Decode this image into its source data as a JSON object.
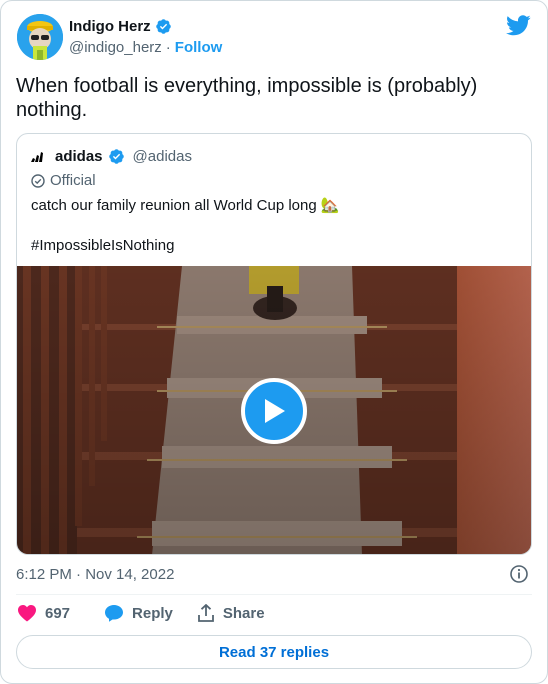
{
  "author": {
    "name": "Indigo Herz",
    "handle": "@indigo_herz",
    "separator": "·",
    "follow_label": "Follow"
  },
  "tweet": {
    "text": "When football is everything, impossible is (probably) nothing."
  },
  "quote": {
    "name": "adidas",
    "handle": "@adidas",
    "official_label": "Official",
    "text": "catch our family reunion all World Cup long 🏡\n\n#ImpossibleIsNothing"
  },
  "meta": {
    "timestamp": "6:12 PM · Nov 14, 2022"
  },
  "actions": {
    "like_count": "697",
    "reply_label": "Reply",
    "share_label": "Share"
  },
  "footer": {
    "read_replies_label": "Read 37 replies"
  },
  "colors": {
    "accent": "#1d9bf0",
    "like": "#f91880",
    "muted": "#536471"
  }
}
